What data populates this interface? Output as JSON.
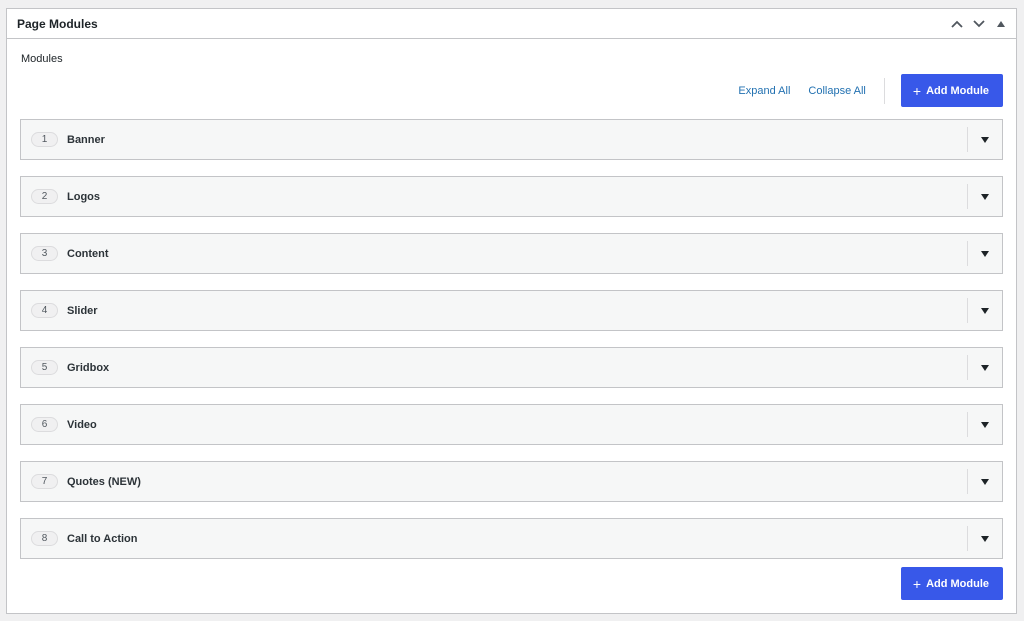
{
  "postbox": {
    "title": "Page Modules",
    "icons": [
      "chevron-up-icon",
      "chevron-down-icon",
      "caret-up-icon"
    ]
  },
  "field": {
    "label": "Modules",
    "expand_all": "Expand All",
    "collapse_all": "Collapse All",
    "add_button_plus": "+",
    "add_button_label": "Add Module"
  },
  "layouts": [
    {
      "order": "1",
      "title": "Banner"
    },
    {
      "order": "2",
      "title": "Logos"
    },
    {
      "order": "3",
      "title": "Content"
    },
    {
      "order": "4",
      "title": "Slider"
    },
    {
      "order": "5",
      "title": "Gridbox"
    },
    {
      "order": "6",
      "title": "Video"
    },
    {
      "order": "7",
      "title": "Quotes (NEW)"
    },
    {
      "order": "8",
      "title": "Call to Action"
    }
  ],
  "colors": {
    "primary_button": "#3858e9",
    "link": "#2271b1",
    "row_background": "#f6f7f7",
    "border": "#c3c4c7"
  }
}
